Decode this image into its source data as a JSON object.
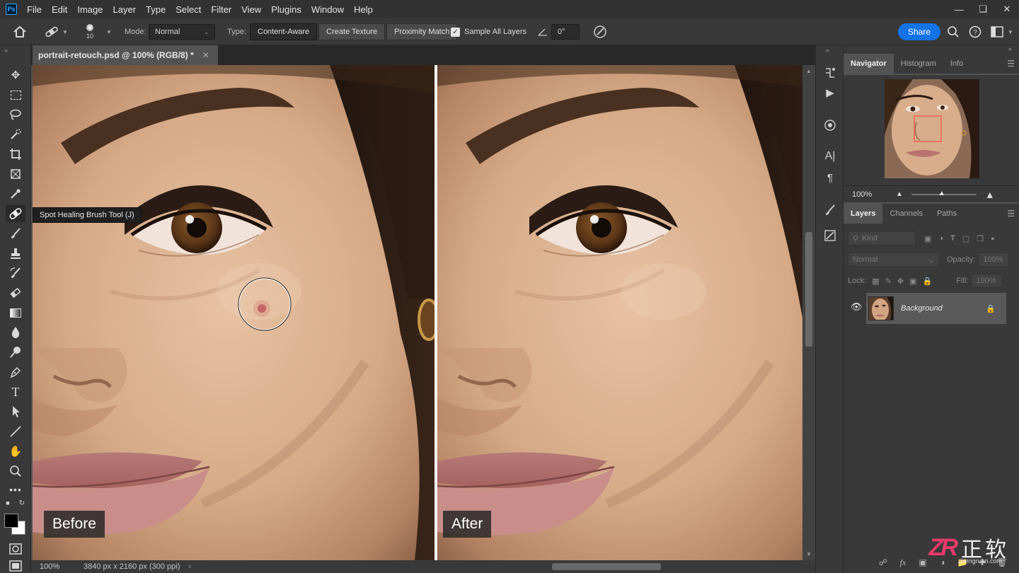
{
  "app": {
    "logo": "Ps"
  },
  "menu": [
    "File",
    "Edit",
    "Image",
    "Layer",
    "Type",
    "Select",
    "Filter",
    "View",
    "Plugins",
    "Window",
    "Help"
  ],
  "options": {
    "brush_size": "10",
    "mode_label": "Mode:",
    "mode_value": "Normal",
    "type_label": "Type:",
    "type_buttons": [
      "Content-Aware",
      "Create Texture",
      "Proximity Match"
    ],
    "sample_all_layers": "Sample All Layers",
    "angle": "0°",
    "share": "Share"
  },
  "document": {
    "tab_title": "portrait-retouch.psd @ 100% (RGB/8) *",
    "before_label": "Before",
    "after_label": "After"
  },
  "tooltip": "Spot Healing Brush Tool (J)",
  "status": {
    "zoom": "100%",
    "doc_size": "3840 px x 2160 px (300 ppi)"
  },
  "navigator": {
    "tabs": [
      "Navigator",
      "Histogram",
      "Info"
    ],
    "zoom": "100%"
  },
  "layers": {
    "tabs": [
      "Layers",
      "Channels",
      "Paths"
    ],
    "kind_placeholder": "Kind",
    "blend": "Normal",
    "opacity_label": "Opacity:",
    "opacity": "100%",
    "lock_label": "Lock:",
    "fill_label": "Fill:",
    "fill": "100%",
    "layer_name": "Background"
  },
  "watermark": {
    "cn": "正软",
    "url": "zhengruan.com"
  },
  "colors": {
    "accent": "#1473e6",
    "panel": "#393939",
    "canvas_bg": "#535353"
  }
}
